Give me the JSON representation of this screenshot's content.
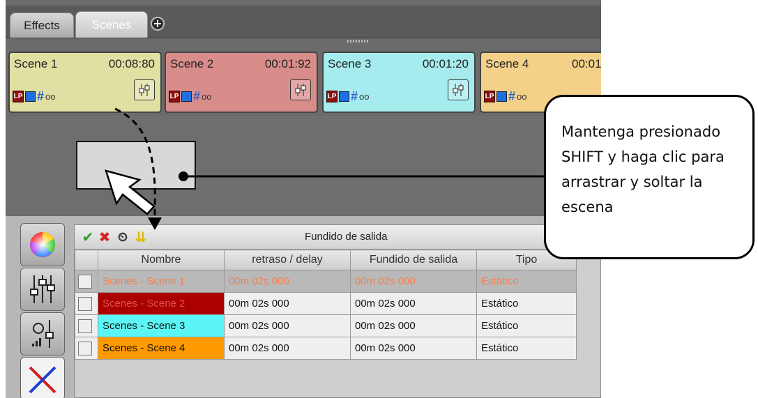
{
  "tabs": [
    {
      "label": "Effects",
      "active": false
    },
    {
      "label": "Scenes",
      "active": true
    }
  ],
  "add_tab_label": "+",
  "scenes": [
    {
      "name": "Scene 1",
      "time": "00:08:80",
      "color": "#e1e0a3",
      "count": "oo"
    },
    {
      "name": "Scene 2",
      "time": "00:01:92",
      "color": "#d98d8b",
      "count": "oo"
    },
    {
      "name": "Scene 3",
      "time": "00:01:20",
      "color": "#a6ecef",
      "count": "oo"
    },
    {
      "name": "Scene 4",
      "time": "00:01",
      "color": "#f4d189",
      "count": "oo"
    }
  ],
  "toolbar": {
    "title": "Fundido de salida"
  },
  "table": {
    "headers": [
      "Nombre",
      "retraso / delay",
      "Fundido de salida",
      "Tipo"
    ],
    "rows": [
      {
        "name": "Scenes - Scene 1",
        "delay": "00m 02s 000",
        "fade": "00m 02s 000",
        "type": "Estático"
      },
      {
        "name": "Scenes - Scene 2",
        "delay": "00m 02s 000",
        "fade": "00m 02s 000",
        "type": "Estático",
        "name_color": "#aa0000"
      },
      {
        "name": "Scenes - Scene 3",
        "delay": "00m 02s 000",
        "fade": "00m 02s 000",
        "type": "Estático",
        "name_color": "#5cf5f5"
      },
      {
        "name": "Scenes - Scene 4",
        "delay": "00m 02s 000",
        "fade": "00m 02s 000",
        "type": "Estático",
        "name_color": "#ff9a00"
      }
    ]
  },
  "callout": {
    "lines": [
      "Mantenga presionado",
      "SHIFT y haga clic para",
      "arrastrar y soltar la",
      "escena"
    ]
  },
  "icons": [
    "plus-icon",
    "lp-icon",
    "color-square-icon",
    "hash-icon",
    "fader-icon",
    "checkmark-icon",
    "delete-icon",
    "timer-icon",
    "arrows-down-icon",
    "color-wheel-icon",
    "sliders-icon",
    "dimmer-icon",
    "crossfade-icon",
    "mouse-cursor-icon"
  ]
}
